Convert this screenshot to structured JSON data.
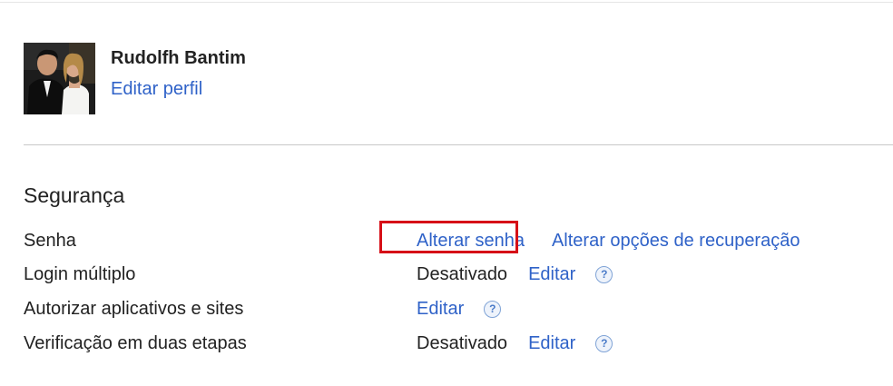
{
  "profile": {
    "name": "Rudolfh Bantim",
    "edit_label": "Editar perfil"
  },
  "security": {
    "title": "Segurança",
    "rows": [
      {
        "label": "Senha",
        "primary_link": "Alterar senha",
        "secondary_link": "Alterar opções de recuperação"
      },
      {
        "label": "Login múltiplo",
        "status": "Desativado",
        "edit": "Editar",
        "help": "?"
      },
      {
        "label": "Autorizar aplicativos e sites",
        "edit": "Editar",
        "help": "?"
      },
      {
        "label": "Verificação em duas etapas",
        "status": "Desativado",
        "edit": "Editar",
        "help": "?"
      }
    ]
  },
  "colors": {
    "link": "#2f62c8",
    "highlight": "#d60f17",
    "text": "#222222"
  }
}
